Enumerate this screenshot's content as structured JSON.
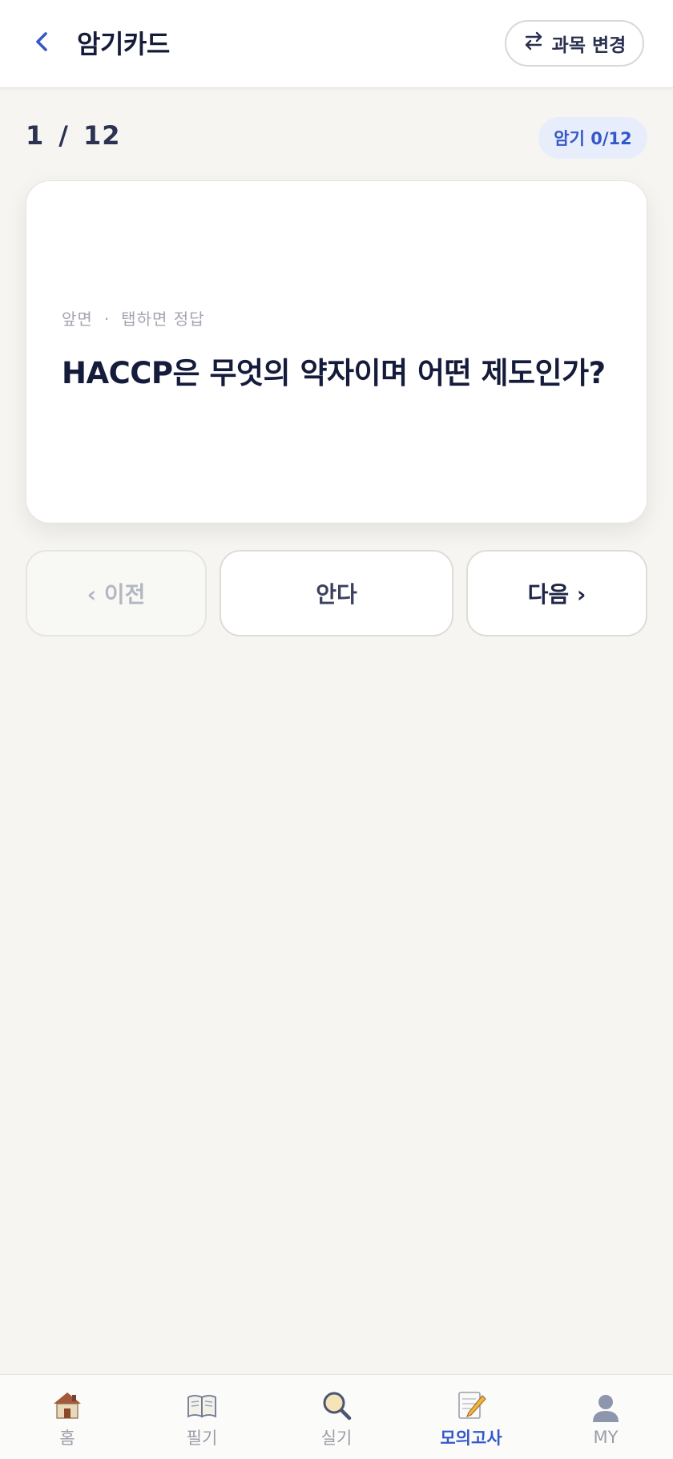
{
  "header": {
    "title": "암기카드",
    "back_icon": "chevron-left-icon",
    "subject_button_label": "과목 변경",
    "subject_button_icon": "swap-arrows-icon"
  },
  "progress": {
    "current": "1",
    "separator": "/",
    "total": "12",
    "memorized_badge": "암기 0/12"
  },
  "card": {
    "side_label": "앞면",
    "dot": "·",
    "tap_hint": "탭하면 정답",
    "question": "HACCP은 무엇의 약자이며 어떤 제도인가?"
  },
  "actions": {
    "prev_label": "‹ 이전",
    "know_label": "안다",
    "next_label": "다음 ›"
  },
  "bottom_nav": {
    "active": "모의고사",
    "items": [
      {
        "label": "홈",
        "icon": "house-icon"
      },
      {
        "label": "필기",
        "icon": "open-book-icon"
      },
      {
        "label": "실기",
        "icon": "magnifier-icon"
      },
      {
        "label": "모의고사",
        "icon": "memo-pencil-icon"
      },
      {
        "label": "MY",
        "icon": "user-silhouette-icon"
      }
    ]
  },
  "colors": {
    "accent": "#3558c7",
    "background": "#f6f5f2",
    "title_text": "#151b3a"
  }
}
